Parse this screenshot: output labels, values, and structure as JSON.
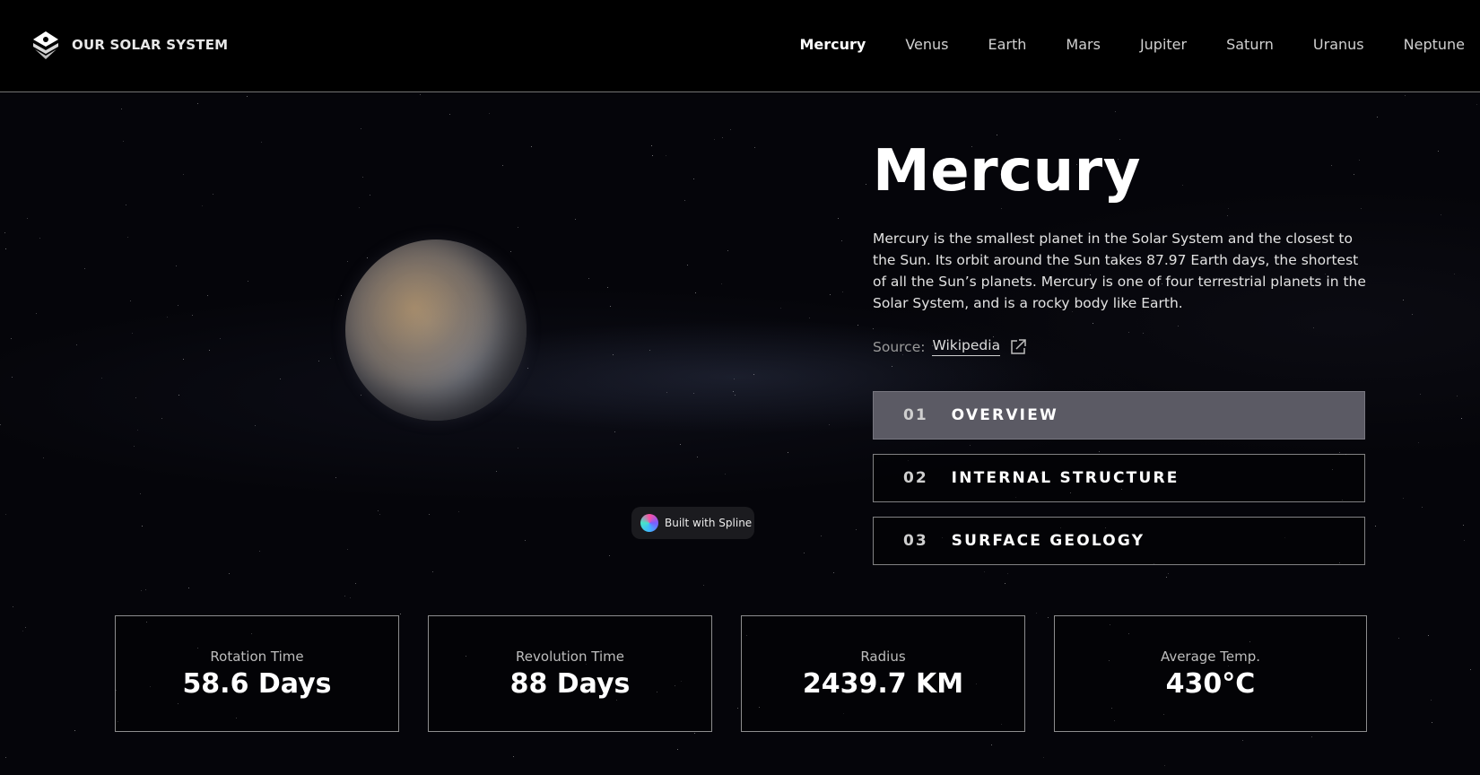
{
  "header": {
    "logo_text": "OUR SOLAR SYSTEM",
    "nav": [
      "Mercury",
      "Venus",
      "Earth",
      "Mars",
      "Jupiter",
      "Saturn",
      "Uranus",
      "Neptune"
    ],
    "active_nav": "Mercury"
  },
  "planet": {
    "name": "Mercury",
    "description": "Mercury is the smallest planet in the Solar System and the closest to the Sun. Its orbit around the Sun takes 87.97 Earth days, the shortest of all the Sun’s planets. Mercury is one of four terrestrial planets in the Solar System, and is a rocky body like Earth.",
    "source_label": "Source:",
    "source_link": "Wikipedia"
  },
  "badge": {
    "text": "Built with Spline"
  },
  "tabs": [
    {
      "num": "01",
      "label": "OVERVIEW"
    },
    {
      "num": "02",
      "label": "INTERNAL STRUCTURE"
    },
    {
      "num": "03",
      "label": "SURFACE GEOLOGY"
    }
  ],
  "active_tab": "OVERVIEW",
  "stats": [
    {
      "label": "Rotation Time",
      "value": "58.6 Days"
    },
    {
      "label": "Revolution Time",
      "value": "88 Days"
    },
    {
      "label": "Radius",
      "value": "2439.7 KM"
    },
    {
      "label": "Average Temp.",
      "value": "430°C"
    }
  ],
  "colors": {
    "background": "#05050a",
    "active_tab": "#5b5a64",
    "text": "#ffffff"
  }
}
